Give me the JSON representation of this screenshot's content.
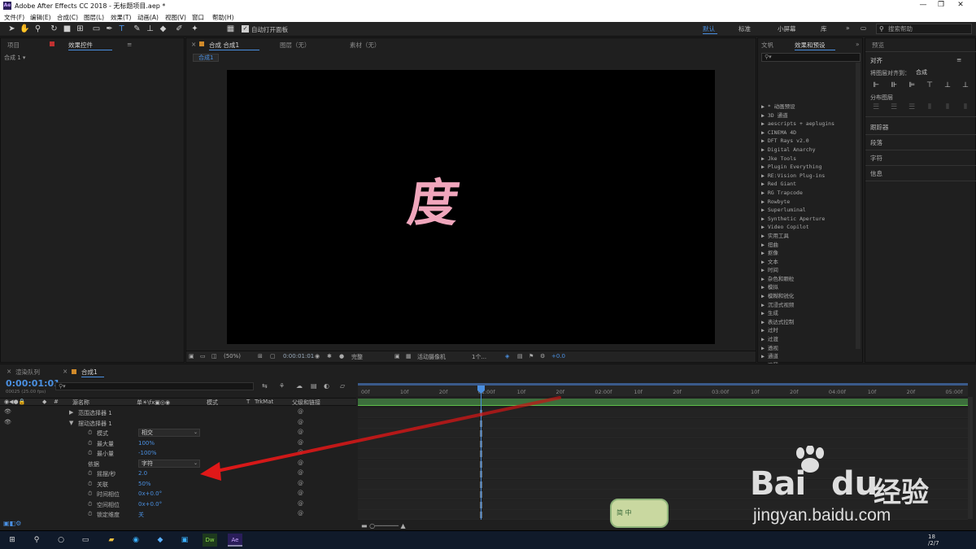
{
  "titlebar": {
    "title": "Adobe After Effects CC 2018 - 无标题项目.aep *",
    "logo": "Ae"
  },
  "menu": [
    "文件(F)",
    "编辑(E)",
    "合成(C)",
    "图层(L)",
    "效果(T)",
    "动画(A)",
    "视图(V)",
    "窗口",
    "帮助(H)"
  ],
  "toolbar": {
    "auto_open": "自动打开面板",
    "workspaces": [
      "默认",
      "标准",
      "小屏幕",
      "库"
    ],
    "workspace_selected": "默认",
    "search_placeholder": "搜索帮助"
  },
  "left_panel": {
    "tabs": [
      "项目",
      "效果控件"
    ],
    "breadcrumb": "合成 1 ▾"
  },
  "viewer": {
    "tabs": [
      "合成 合成1",
      "图层（无）",
      "素材（无）"
    ],
    "comp_tab": "合成1",
    "glyph": "度",
    "glyph_color": "#f0a6bc",
    "bottom": {
      "zoom": "(50%)",
      "time": "0:00:01:01",
      "quality": "完整",
      "camera": "活动摄像机",
      "views": "1个...",
      "offset": "+0.0"
    }
  },
  "effects_panel": {
    "tabs": [
      "文帆",
      "效果和预设"
    ],
    "items": [
      "▶ * 动画预设",
      "▶ 3D 通道",
      "▶ aescripts + aeplugins",
      "▶ CINEMA 4D",
      "▶ DFT Rays v2.0",
      "▶ Digital Anarchy",
      "▶ Jke Tools",
      "▶ Plugin Everything",
      "▶ RE:Vision Plug-ins",
      "▶ Red Giant",
      "▶ RG Trapcode",
      "▶ Rowbyte",
      "▶ Superluminal",
      "▶ Synthetic Aperture",
      "▶ Video Copilot",
      "▶ 实用工具",
      "▶ 扭曲",
      "▶ 抠像",
      "▶ 文本",
      "▶ 时间",
      "▶ 杂色和颗粒",
      "▶ 模拟",
      "▶ 模糊和锐化",
      "▶ 沉浸式视频",
      "▶ 生成",
      "▶ 表达式控制",
      "▶ 过时",
      "▶ 过渡",
      "▶ 透视",
      "▶ 通道",
      "▶ 遮罩",
      "▶ 音频",
      "▶ 颜色校正",
      "▶ 音效设"
    ]
  },
  "align_panel": {
    "tab": "预览",
    "title": "对齐",
    "align_to_label": "将图层对齐到：",
    "align_to_value": "合成",
    "distribute_label": "分布图层",
    "sections": [
      "跟踪器",
      "段落",
      "字符",
      "信息"
    ]
  },
  "timeline": {
    "tabs": [
      "渲染队列",
      "合成1"
    ],
    "timecode": "0:00:01:01",
    "fps": "00025 (25.00 fps)",
    "headers": {
      "layer_name": "源名称",
      "switches": "单☀\\fx▣◎◉",
      "mode": "模式",
      "t": "T",
      "trkmat": "TrkMat",
      "parent": "父级和链接"
    },
    "rows": [
      {
        "indent": 1,
        "label": "范围选择器 1",
        "type": "group"
      },
      {
        "indent": 1,
        "label": "摆动选择器 1",
        "type": "group-open"
      },
      {
        "indent": 2,
        "label": "模式",
        "dropdown": "相交"
      },
      {
        "indent": 2,
        "label": "最大量",
        "value": "100%"
      },
      {
        "indent": 2,
        "label": "最小量",
        "value": "-100%"
      },
      {
        "indent": 2,
        "label": "依据",
        "dropdown": "字符",
        "nostop": true
      },
      {
        "indent": 2,
        "label": "摇摆/秒",
        "value": "2.0"
      },
      {
        "indent": 2,
        "label": "关联",
        "value": "50%"
      },
      {
        "indent": 2,
        "label": "时间相位",
        "value": "0x+0.0°"
      },
      {
        "indent": 2,
        "label": "空间相位",
        "value": "0x+0.0°"
      },
      {
        "indent": 2,
        "label": "锁定维度",
        "value": "关"
      }
    ],
    "ruler": [
      "00f",
      "10f",
      "20f",
      "01:00f",
      "10f",
      "20f",
      "02:00f",
      "10f",
      "20f",
      "03:00f",
      "10f",
      "20f",
      "04:00f",
      "10f",
      "20f",
      "05:00f"
    ]
  },
  "watermark": {
    "brand": "Bai",
    "brand2": "du",
    "cn": "经验",
    "url": "jingyan.baidu.com",
    "color": "#ffffff"
  },
  "overlay": {
    "sticker": "简 中"
  },
  "taskbar": {
    "icons": [
      "windows-icon",
      "search-icon",
      "cortana-icon",
      "task-view-icon",
      "file-explorer-icon",
      "qq-browser-icon",
      "photoshop-icon",
      "app-icon",
      "dreamweaver-icon",
      "after-effects-icon"
    ],
    "clock": "18\n/2/7"
  }
}
